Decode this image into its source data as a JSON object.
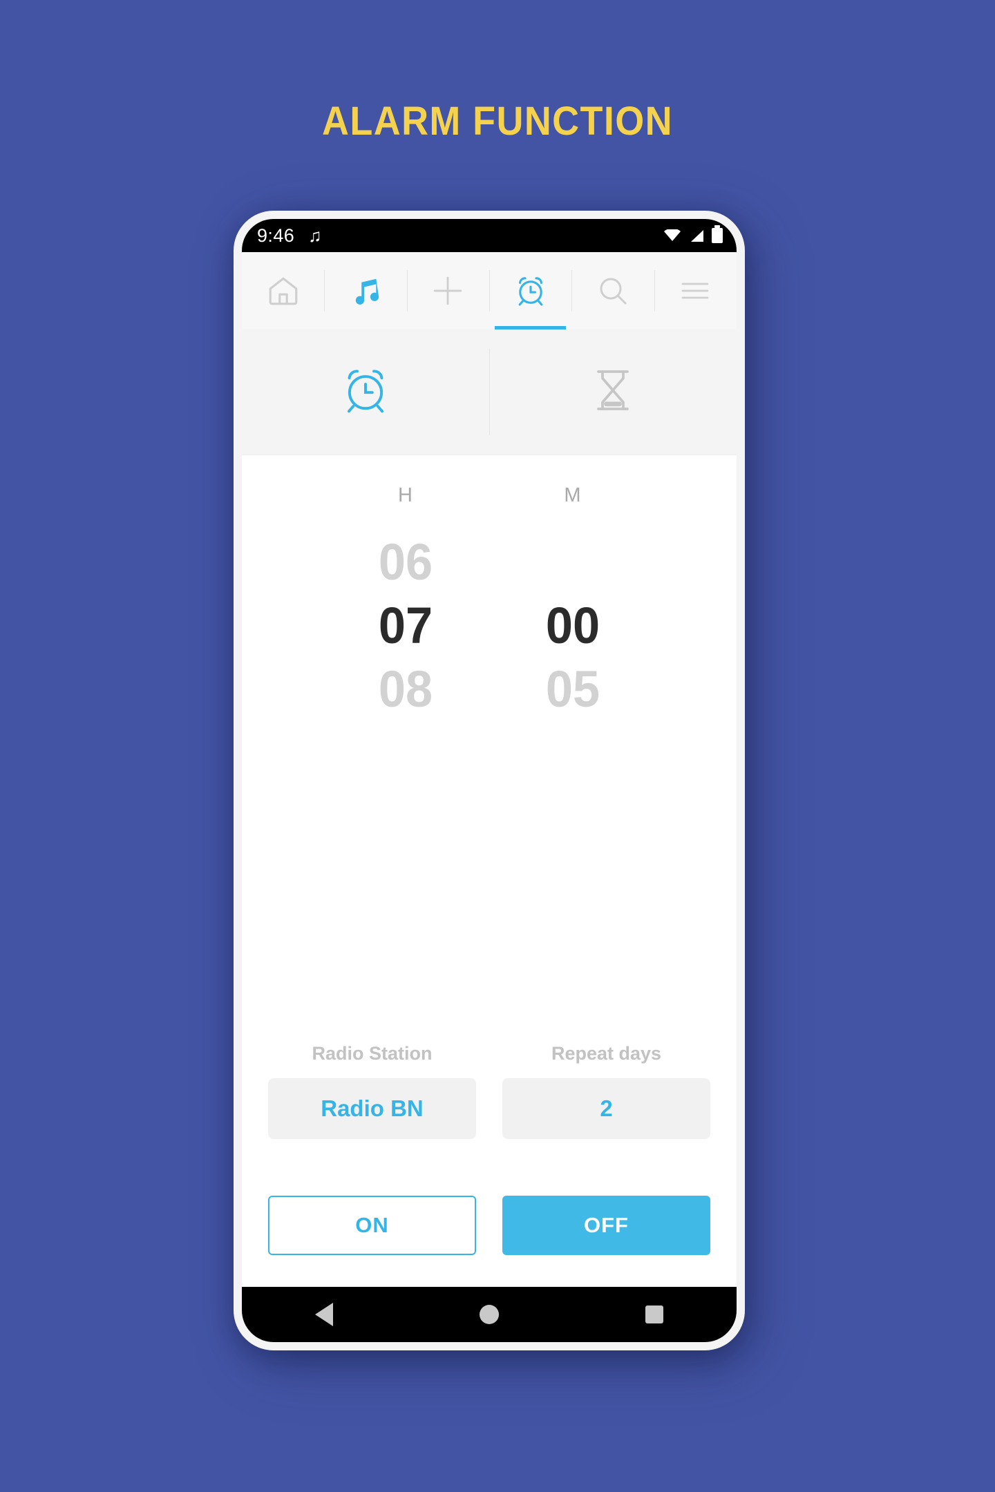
{
  "page": {
    "title": "ALARM FUNCTION",
    "background_color": "#4354A5",
    "title_color": "#F5D24E",
    "accent_color": "#35B4E8"
  },
  "statusbar": {
    "time": "9:46",
    "music_icon": "♫",
    "icons": [
      "wifi-icon",
      "signal-icon",
      "battery-icon"
    ]
  },
  "topnav": {
    "items": [
      {
        "name": "home",
        "icon": "home-icon",
        "active": false
      },
      {
        "name": "music",
        "icon": "music-note-icon",
        "active": false
      },
      {
        "name": "add",
        "icon": "plus-icon",
        "active": false
      },
      {
        "name": "alarm",
        "icon": "alarm-clock-icon",
        "active": true
      },
      {
        "name": "search",
        "icon": "search-icon",
        "active": false
      },
      {
        "name": "menu",
        "icon": "hamburger-icon",
        "active": false
      }
    ]
  },
  "tabs": [
    {
      "name": "alarm",
      "icon": "alarm-clock-icon",
      "active": true
    },
    {
      "name": "timer",
      "icon": "hourglass-icon",
      "active": false
    }
  ],
  "picker": {
    "hour": {
      "label": "H",
      "previous": "06",
      "selected": "07",
      "next": "08"
    },
    "minute": {
      "label": "M",
      "previous": "",
      "selected": "00",
      "next": "05"
    }
  },
  "fields": [
    {
      "label": "Radio Station",
      "value": "Radio BN"
    },
    {
      "label": "Repeat days",
      "value": "2"
    }
  ],
  "buttons": {
    "on": "ON",
    "off": "OFF"
  },
  "android_nav": {
    "back": "back-triangle-icon",
    "home": "home-circle-icon",
    "recents": "recents-square-icon"
  }
}
